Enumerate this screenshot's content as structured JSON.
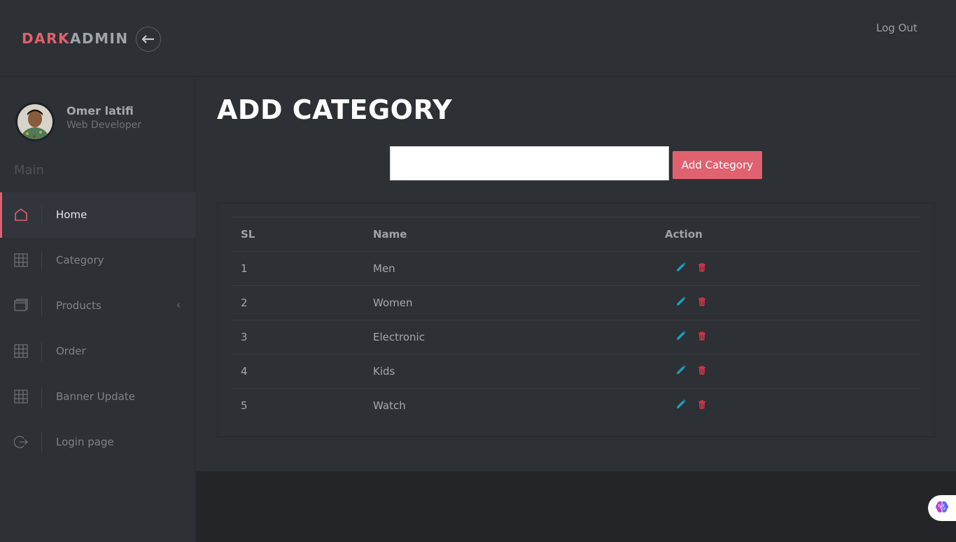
{
  "brand": {
    "part1": "DARK",
    "part2": "ADMIN"
  },
  "header": {
    "logout": "Log Out"
  },
  "profile": {
    "name": "Omer latifi",
    "role": "Web Developer"
  },
  "sidebar": {
    "section": "Main",
    "items": [
      {
        "label": "Home",
        "icon": "home-icon",
        "active": true
      },
      {
        "label": "Category",
        "icon": "grid-icon"
      },
      {
        "label": "Products",
        "icon": "window-icon",
        "chevron": "‹"
      },
      {
        "label": "Order",
        "icon": "grid-icon"
      },
      {
        "label": "Banner Update",
        "icon": "grid-icon"
      },
      {
        "label": "Login page",
        "icon": "logout-icon"
      }
    ]
  },
  "page": {
    "title": "ADD CATEGORY",
    "input_value": "",
    "add_button": "Add Category"
  },
  "table": {
    "headers": [
      "SL",
      "Name",
      "Action"
    ],
    "rows": [
      {
        "sl": "1",
        "name": "Men"
      },
      {
        "sl": "2",
        "name": "Women"
      },
      {
        "sl": "3",
        "name": "Electronic"
      },
      {
        "sl": "4",
        "name": "Kids"
      },
      {
        "sl": "5",
        "name": "Watch"
      }
    ]
  },
  "colors": {
    "accent": "#e0616f",
    "edit": "#1aa3c2",
    "delete": "#dc3545",
    "background": "#2d3035"
  }
}
